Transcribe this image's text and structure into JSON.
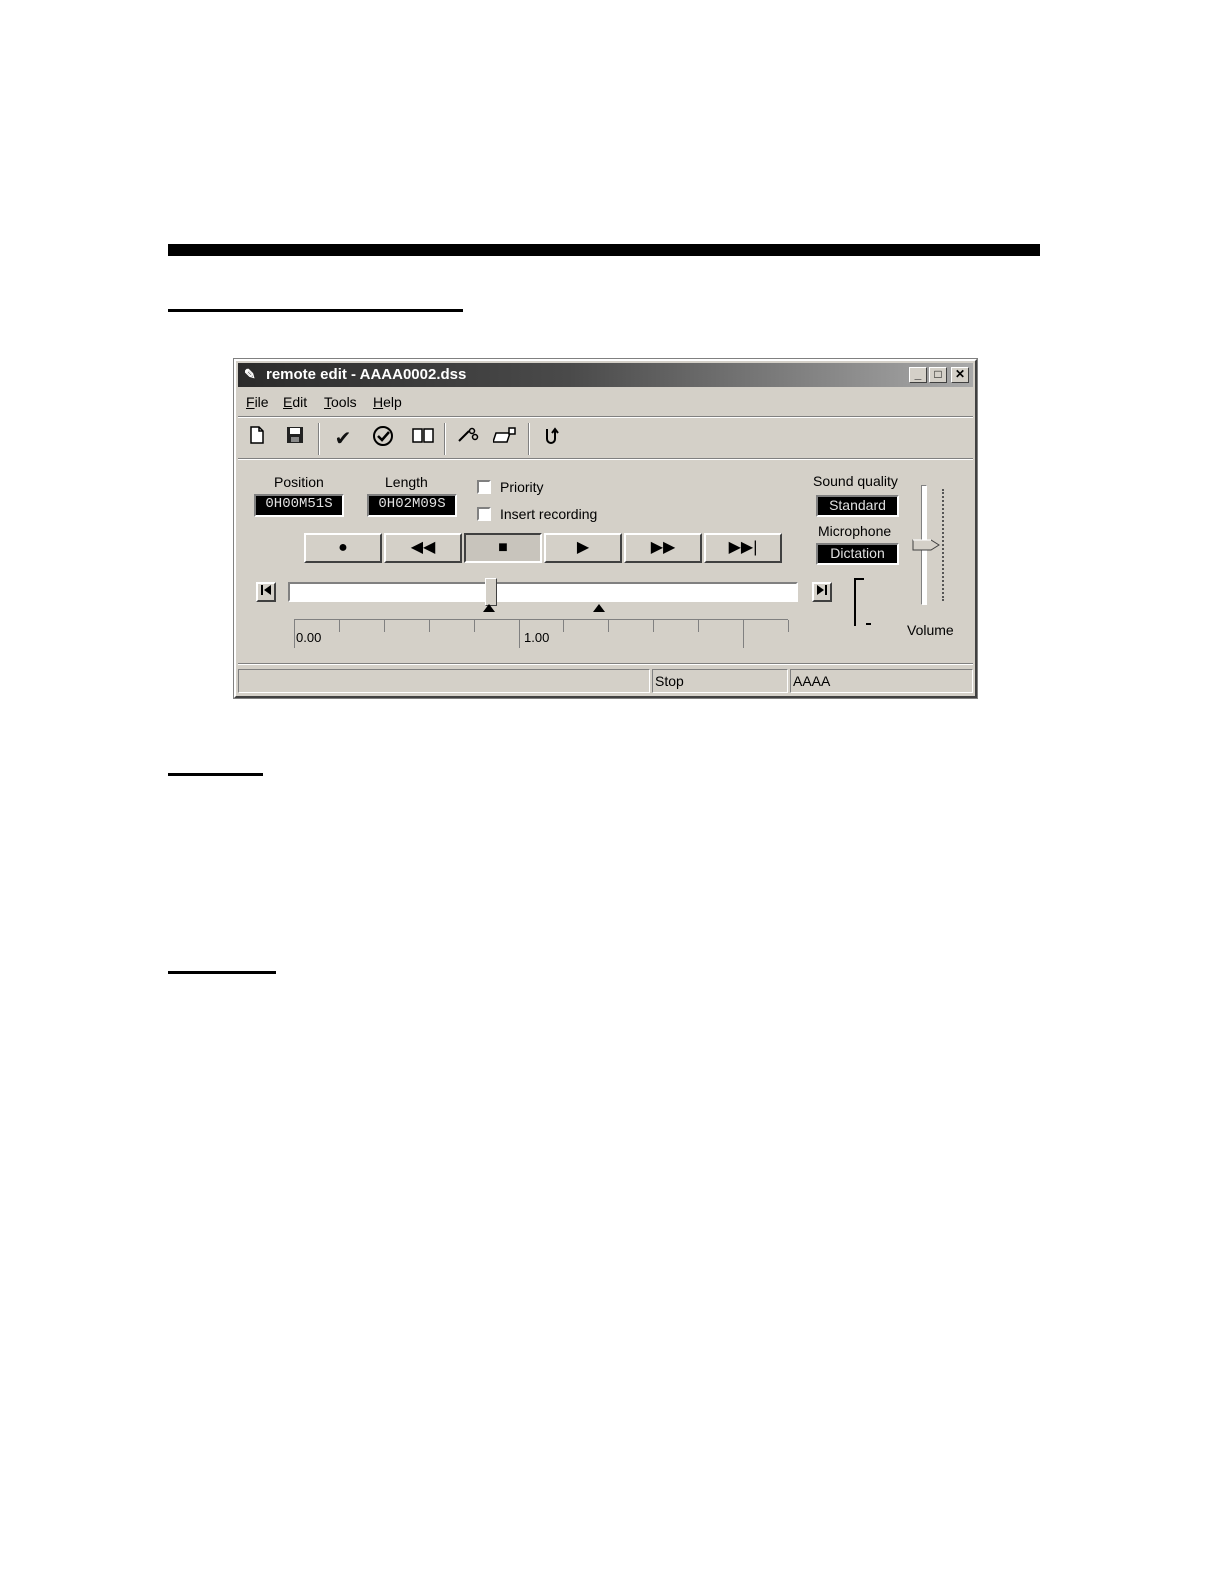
{
  "window": {
    "title": "remote edit - AAAA0002.dss",
    "caption_buttons": {
      "minimize": "_",
      "maximize": "□",
      "close": "✕"
    }
  },
  "menu": [
    {
      "label": "File",
      "accel": "F",
      "rest": "ile"
    },
    {
      "label": "Edit",
      "accel": "E",
      "rest": "dit"
    },
    {
      "label": "Tools",
      "accel": "T",
      "rest": "ools"
    },
    {
      "label": "Help",
      "accel": "H",
      "rest": "elp"
    }
  ],
  "toolbar": {
    "icons": [
      "new-file-icon",
      "save-icon",
      "checkmark-icon",
      "check-circle-icon",
      "book-icon",
      "cut-icon",
      "insert-icon",
      "undo-icon"
    ]
  },
  "position": {
    "label": "Position",
    "value": "0H00M51S"
  },
  "length": {
    "label": "Length",
    "value": "0H02M09S"
  },
  "options": {
    "priority": {
      "label": "Priority",
      "checked": false
    },
    "insert_recording": {
      "label": "Insert recording",
      "checked": false
    }
  },
  "sound_quality": {
    "label": "Sound quality",
    "value": "Standard"
  },
  "microphone": {
    "label": "Microphone",
    "value": "Dictation"
  },
  "volume": {
    "label": "Volume",
    "level": 0.5
  },
  "transport": {
    "record": "●",
    "rewind": "◀◀",
    "stop": "■",
    "play": "▶",
    "fast_forward": "▶▶",
    "end": "▶▶|"
  },
  "timeline": {
    "position_fraction": 0.395,
    "marker_fraction": 0.61,
    "ruler_labels": [
      "0.00",
      "1.00"
    ]
  },
  "status": {
    "message": "",
    "state": "Stop",
    "author": "AAAA"
  }
}
